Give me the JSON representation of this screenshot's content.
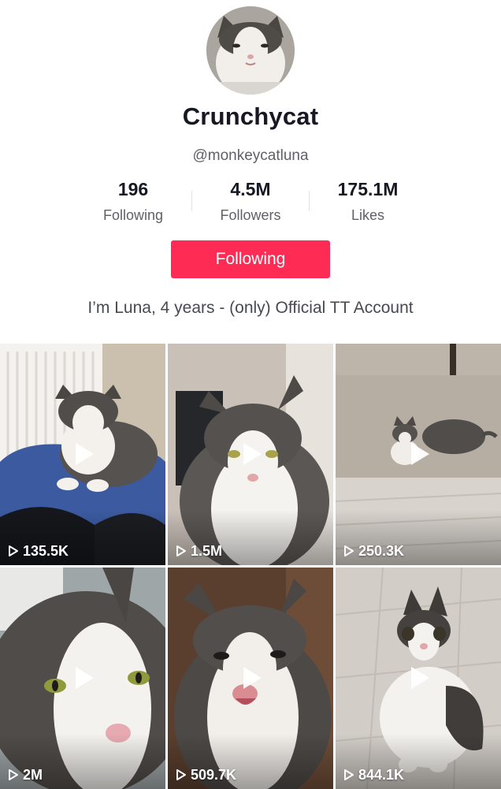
{
  "profile": {
    "display_name": "Crunchycat",
    "username": "@monkeycatluna",
    "bio": "I’m Luna, 4 years - (only) Official TT Account"
  },
  "stats": {
    "following": {
      "value": "196",
      "label": "Following"
    },
    "followers": {
      "value": "4.5M",
      "label": "Followers"
    },
    "likes": {
      "value": "175.1M",
      "label": "Likes"
    }
  },
  "follow_button": {
    "label": "Following",
    "color": "#fe2c55"
  },
  "videos": [
    {
      "views": "135.5K"
    },
    {
      "views": "1.5M"
    },
    {
      "views": "250.3K"
    },
    {
      "views": "2M"
    },
    {
      "views": "509.7K"
    },
    {
      "views": "844.1K"
    }
  ],
  "icons": {
    "play": "play-icon",
    "views": "play-outline-icon"
  }
}
